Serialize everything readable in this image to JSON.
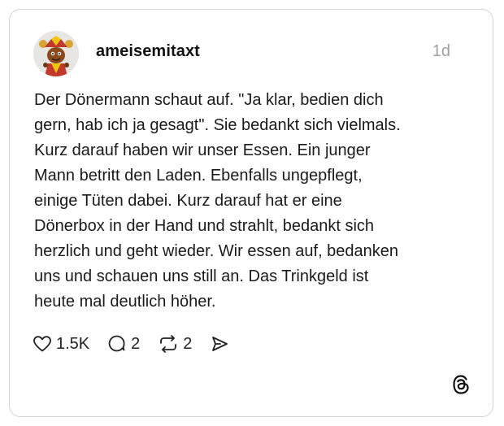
{
  "post": {
    "username": "ameisemitaxt",
    "timestamp": "1d",
    "text": "Der Dönermann schaut auf. \"Ja klar, bedien dich\ngern, hab ich ja gesagt\". Sie bedankt sich vielmals.\nKurz darauf haben wir unser Essen. Ein junger\nMann betritt den Laden. Ebenfalls ungepflegt,\neinige Tüten dabei. Kurz darauf hat er eine\nDönerbox in der Hand und strahlt, bedankt sich\nherzlich und geht wieder. Wir essen auf, bedanken\nuns und schauen uns still an. Das Trinkgeld ist\nheute mal deutlich höher."
  },
  "actions": {
    "likes": "1.5K",
    "comments": "2",
    "reposts": "2"
  },
  "icons": {
    "like": "heart-icon",
    "comment": "comment-bubble-icon",
    "repost": "repost-icon",
    "share": "send-icon",
    "brand": "threads-logo-icon"
  },
  "colors": {
    "border": "#d4d4d4",
    "text": "#1a1a1a",
    "muted": "#a0a0a0"
  }
}
